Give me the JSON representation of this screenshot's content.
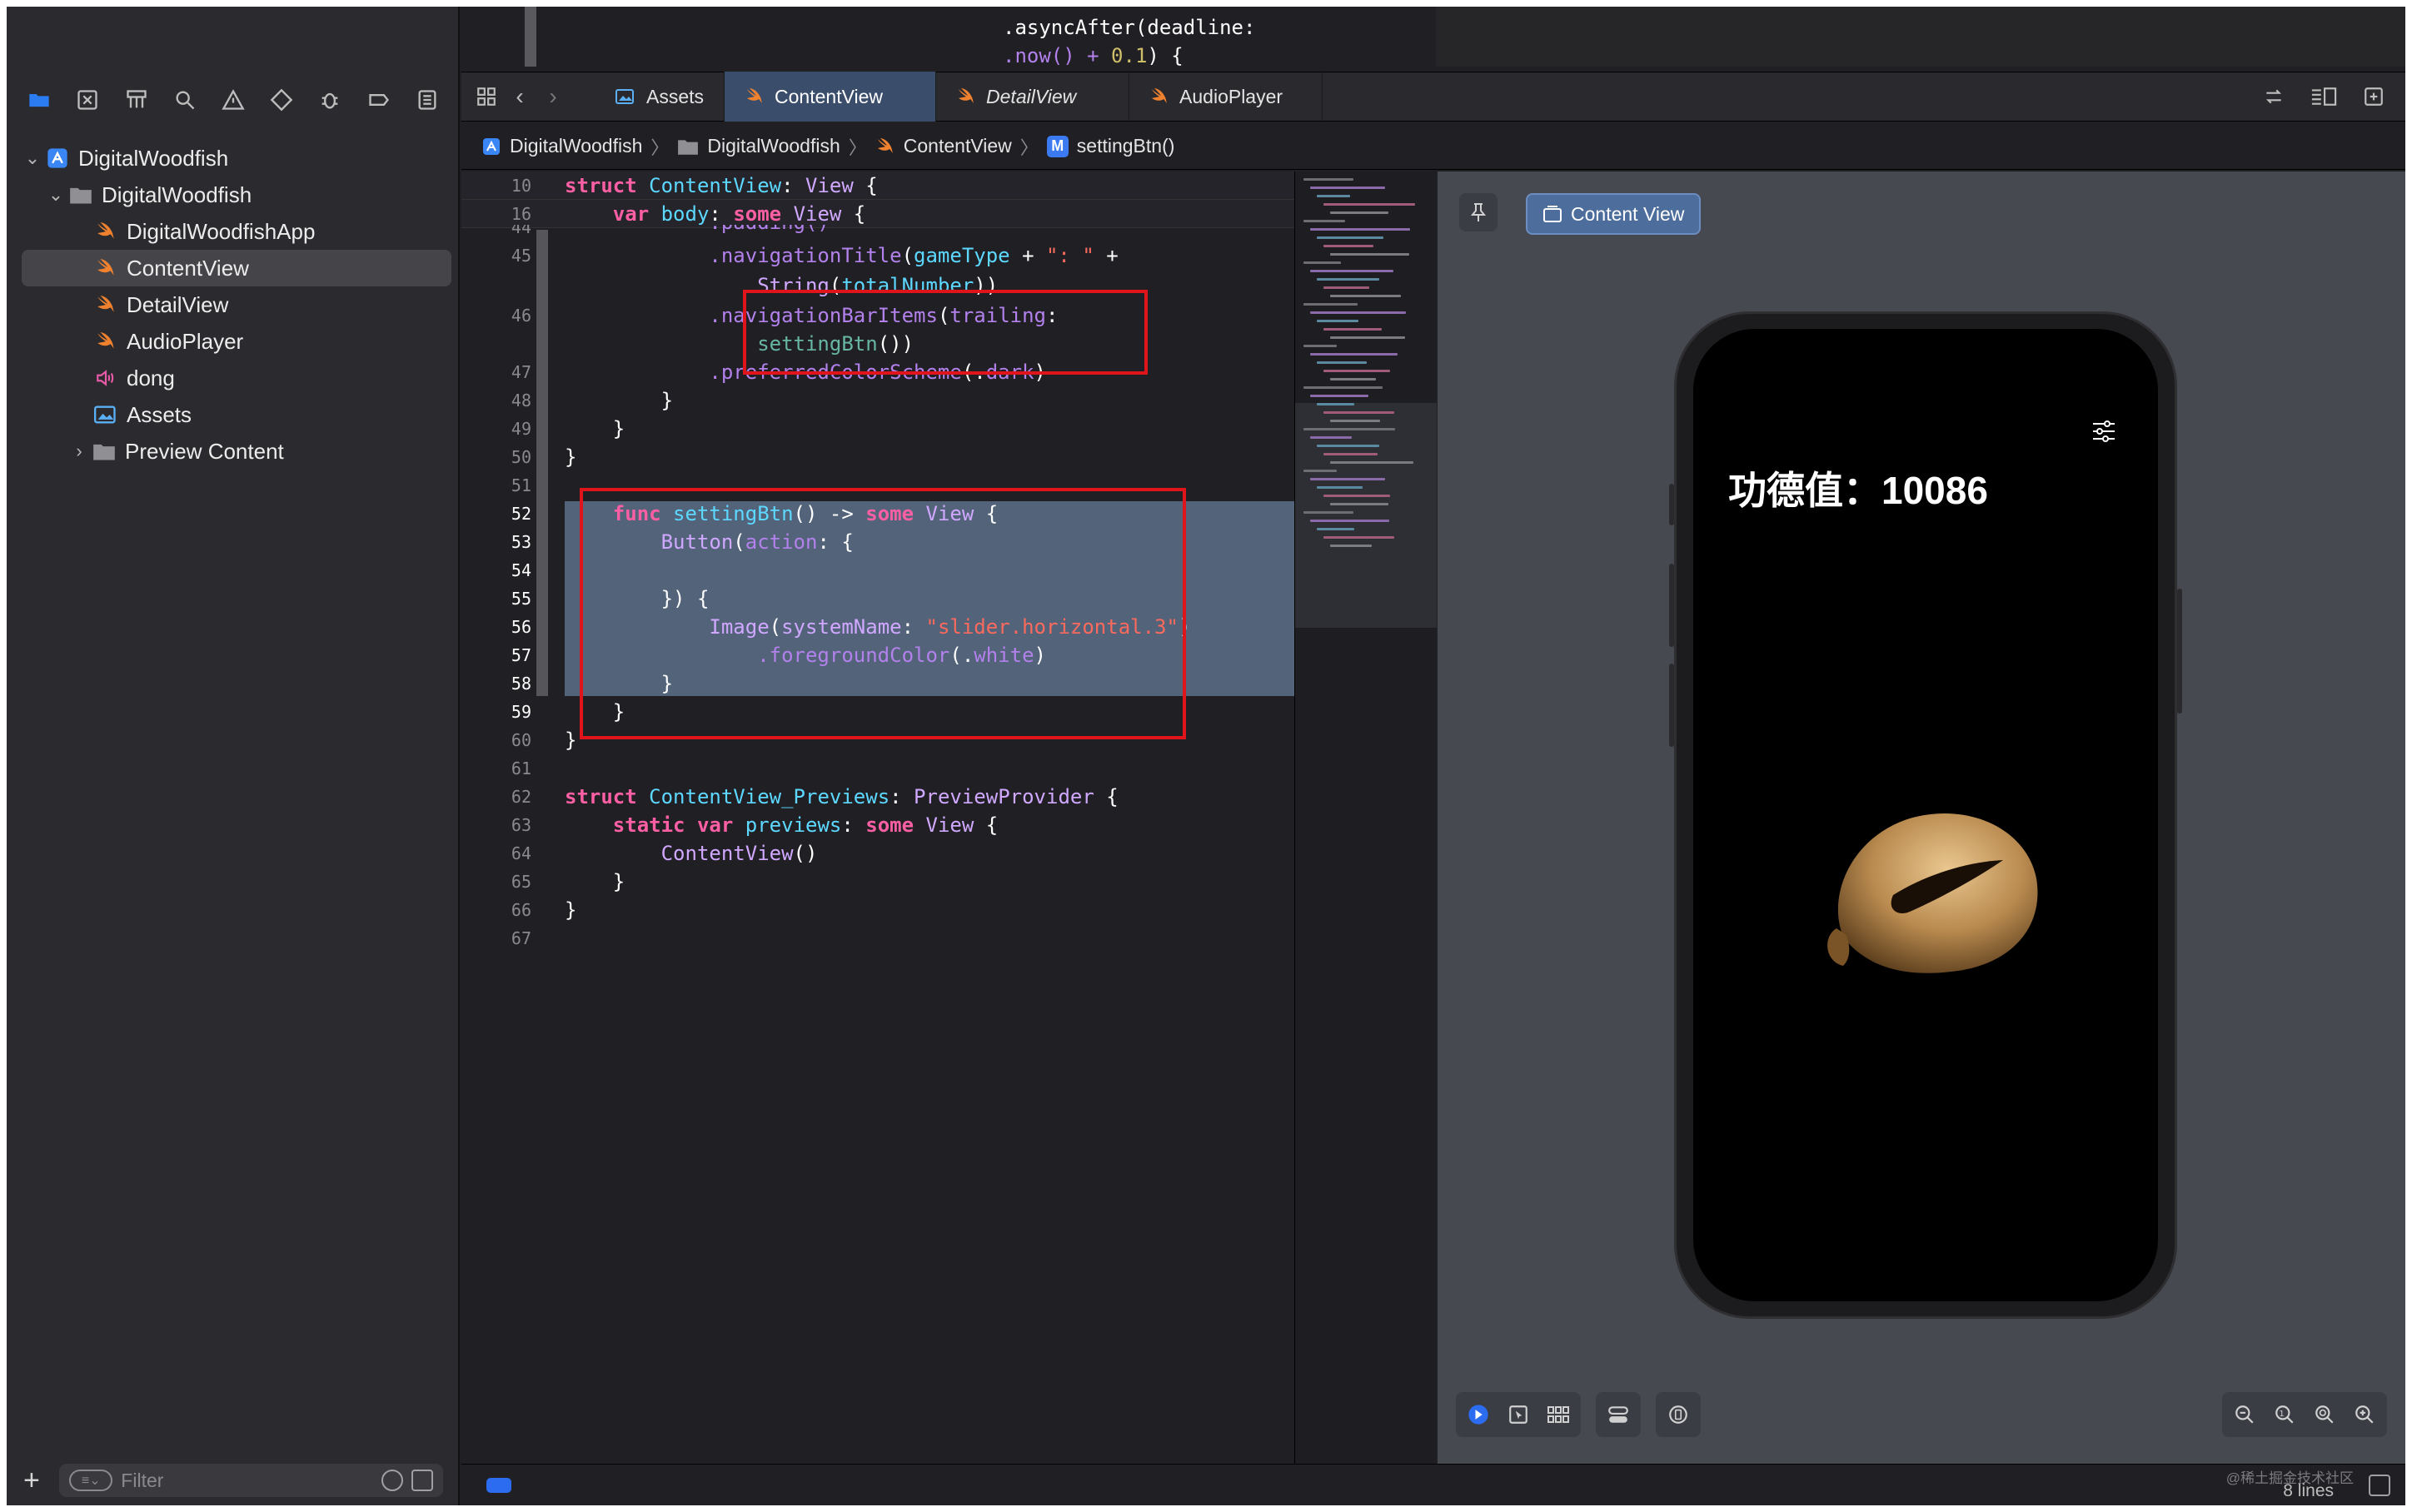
{
  "peek": {
    "line1": ".asyncAfter(deadline:",
    "line2_a": ".now() + ",
    "line2_b": "0.1",
    "line2_c": ") {"
  },
  "sidebar": {
    "nav_icons": [
      "folder-icon",
      "source-control-icon",
      "symbol-icon",
      "search-icon",
      "warning-icon",
      "test-icon",
      "debug-icon",
      "breakpoint-icon",
      "report-icon"
    ],
    "tree": [
      {
        "label": "DigitalWoodfish",
        "icon": "project-icon",
        "level": 0,
        "expanded": true
      },
      {
        "label": "DigitalWoodfish",
        "icon": "folder-icon",
        "level": 1,
        "expanded": true
      },
      {
        "label": "DigitalWoodfishApp",
        "icon": "swift-icon",
        "level": 2
      },
      {
        "label": "ContentView",
        "icon": "swift-icon",
        "level": 2,
        "selected": true
      },
      {
        "label": "DetailView",
        "icon": "swift-icon",
        "level": 2
      },
      {
        "label": "AudioPlayer",
        "icon": "swift-icon",
        "level": 2
      },
      {
        "label": "dong",
        "icon": "audio-icon",
        "level": 2
      },
      {
        "label": "Assets",
        "icon": "assets-icon",
        "level": 2
      },
      {
        "label": "Preview Content",
        "icon": "folder-icon",
        "level": 2,
        "collapsed": true
      }
    ],
    "filter_placeholder": "Filter"
  },
  "tabs": [
    {
      "label": "Assets",
      "icon": "assets-icon"
    },
    {
      "label": "ContentView",
      "icon": "swift-icon",
      "active": true
    },
    {
      "label": "DetailView",
      "icon": "swift-icon",
      "italic": true
    },
    {
      "label": "AudioPlayer",
      "icon": "swift-icon"
    }
  ],
  "breadcrumb": [
    "DigitalWoodfish",
    "DigitalWoodfish",
    "ContentView",
    "settingBtn()"
  ],
  "editor": {
    "lines": [
      {
        "n": "10",
        "y": 0
      },
      {
        "n": "16",
        "y": 34
      },
      {
        "n": "44"
      },
      {
        "n": "45"
      },
      {
        "n": "46"
      },
      {
        "n": "47"
      },
      {
        "n": "48"
      },
      {
        "n": "49"
      },
      {
        "n": "50"
      },
      {
        "n": "51"
      },
      {
        "n": "52"
      },
      {
        "n": "53"
      },
      {
        "n": "54"
      },
      {
        "n": "55"
      },
      {
        "n": "56"
      },
      {
        "n": "57"
      },
      {
        "n": "58"
      },
      {
        "n": "59"
      },
      {
        "n": "60"
      },
      {
        "n": "61"
      },
      {
        "n": "62"
      },
      {
        "n": "63"
      },
      {
        "n": "64"
      },
      {
        "n": "65"
      },
      {
        "n": "66"
      },
      {
        "n": "67"
      }
    ]
  },
  "canvas": {
    "preview_label": "Content View",
    "merit_text": "功德值：10086"
  },
  "status": {
    "watermark": "@稀土掘金技术社区",
    "lines": "8 lines"
  },
  "colors": {
    "keyword": "#fc5fa3",
    "type": "#5dd8ff",
    "method": "#b281eb",
    "string": "#fc6a5d",
    "selection": "#53637a",
    "highlight_box": "#e0141b",
    "swift_orange": "#f0822f"
  }
}
